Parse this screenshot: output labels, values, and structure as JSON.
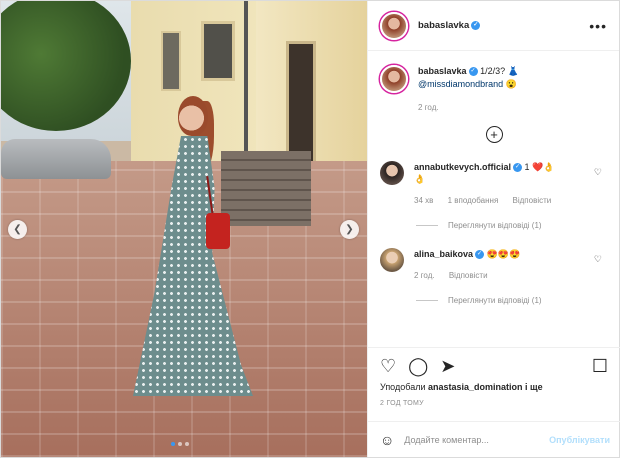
{
  "post": {
    "author": "babaslavka",
    "more_icon": "more-horizontal-icon",
    "caption_text": "1/2/3? 👗",
    "caption_mention": "@missdiamondbrand",
    "caption_emoji": "😮",
    "caption_time": "2 год."
  },
  "photo": {
    "prev_icon": "chevron-left-icon",
    "next_icon": "chevron-right-icon",
    "slides_total": 3,
    "slide_active": 1
  },
  "comments": [
    {
      "username": "annabutkevych.official",
      "text": "1 ❤️👌",
      "extra": "👌",
      "time": "34 хв",
      "likes": "1 вподобання",
      "reply": "Відповісти",
      "view_replies": "Переглянути відповіді (1)"
    },
    {
      "username": "alina_baikova",
      "text": "😍😍😍",
      "time": "2 год.",
      "reply": "Відповісти",
      "view_replies": "Переглянути відповіді (1)"
    }
  ],
  "actions": {
    "liked_by_prefix": "Уподобали",
    "liked_by_user": "anastasia_domination",
    "liked_by_suffix": "і ще",
    "timestamp": "2 ГОД ТОМУ"
  },
  "add_comment": {
    "placeholder": "Додайте коментар...",
    "publish": "Опублікувати"
  },
  "colors": {
    "accent": "#3897f0",
    "publish_disabled": "#b2dffc"
  }
}
